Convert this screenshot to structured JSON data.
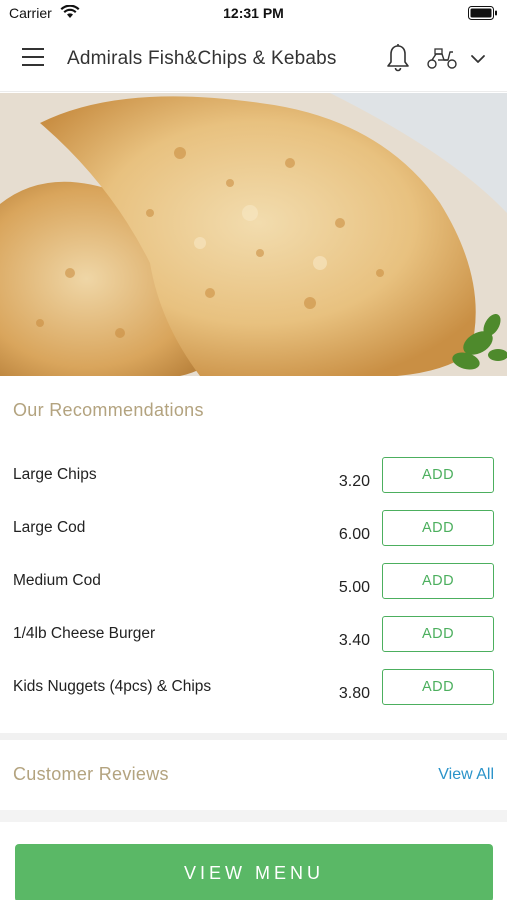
{
  "status_bar": {
    "carrier": "Carrier",
    "time": "12:31 PM"
  },
  "header": {
    "title": "Admirals Fish&Chips & Kebabs",
    "icons": [
      "menu-icon",
      "bell-icon",
      "scooter-icon",
      "chevron-down-icon"
    ]
  },
  "recommendations": {
    "title": "Our Recommendations",
    "items": [
      {
        "name": "Large Chips",
        "price": "3.20",
        "add_label": "ADD"
      },
      {
        "name": "Large Cod",
        "price": "6.00",
        "add_label": "ADD"
      },
      {
        "name": "Medium Cod",
        "price": "5.00",
        "add_label": "ADD"
      },
      {
        "name": "1/4lb Cheese Burger",
        "price": "3.40",
        "add_label": "ADD"
      },
      {
        "name": "Kids Nuggets (4pcs) & Chips",
        "price": "3.80",
        "add_label": "ADD"
      }
    ]
  },
  "reviews": {
    "title": "Customer Reviews",
    "view_all_label": "View All"
  },
  "view_menu_label": "VIEW MENU",
  "colors": {
    "accent_green": "#5ab866",
    "section_title": "#b3a37f",
    "link_blue": "#2a93c9"
  }
}
